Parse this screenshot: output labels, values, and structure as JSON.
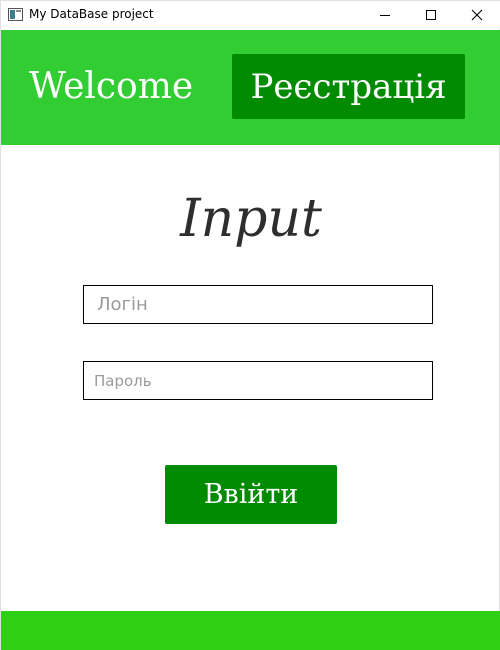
{
  "window": {
    "title": "My DataBase project"
  },
  "header": {
    "welcome_text": "Welcome",
    "register_label": "Реєстрація"
  },
  "main": {
    "heading": "Input",
    "login_placeholder": "Логін",
    "password_placeholder": "Пароль",
    "enter_label": "Ввійти"
  },
  "colors": {
    "header_bg": "#32cd32",
    "button_bg": "#008b00",
    "footer_bg": "#2ecf14"
  },
  "icons": {
    "app": "app-window-icon",
    "minimize": "minimize-icon",
    "maximize": "maximize-icon",
    "close": "close-icon"
  }
}
